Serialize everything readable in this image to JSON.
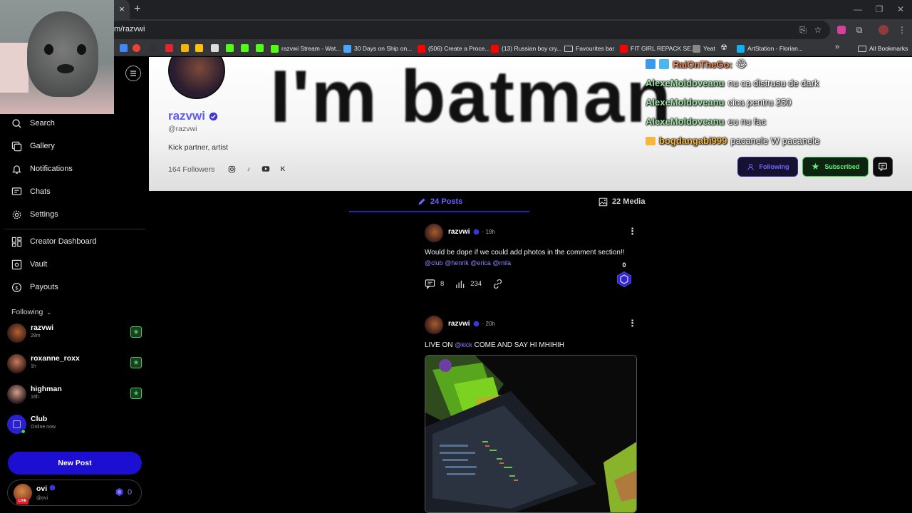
{
  "browser": {
    "url": "m/razvwi",
    "new_tab": "+",
    "tab_close": "×",
    "bookmarks": [
      {
        "label": "razvwi Stream - Wat...",
        "color": "#53fc18"
      },
      {
        "label": "30 Days on Ship on...",
        "color": "#4aa3ff"
      },
      {
        "label": "(506) Create a Proce...",
        "color": "#ff0000"
      },
      {
        "label": "(13) Russian boy cry...",
        "color": "#ff0000"
      },
      {
        "label": "Favourites bar",
        "color": "folder"
      },
      {
        "label": "FIT GIRL REPACK SE...",
        "color": "#ff0000"
      },
      {
        "label": "Yeat",
        "color": "#888888"
      },
      {
        "label": "ArtStation - Florian...",
        "color": "#13aff0"
      }
    ],
    "more_bookmarks": "»",
    "all_bookmarks": "All Bookmarks"
  },
  "sidebar": {
    "nav": [
      {
        "label": "Search",
        "icon": "search-icon"
      },
      {
        "label": "Gallery",
        "icon": "gallery-icon"
      },
      {
        "label": "Notifications",
        "icon": "bell-icon"
      },
      {
        "label": "Chats",
        "icon": "chat-icon"
      },
      {
        "label": "Settings",
        "icon": "gear-icon"
      }
    ],
    "creator": [
      {
        "label": "Creator Dashboard",
        "icon": "dashboard-icon"
      },
      {
        "label": "Vault",
        "icon": "vault-icon"
      },
      {
        "label": "Payouts",
        "icon": "dollar-icon"
      }
    ],
    "following_label": "Following",
    "following": [
      {
        "name": "razvwi",
        "time": "28m"
      },
      {
        "name": "roxanne_roxx",
        "time": "1h"
      },
      {
        "name": "highman",
        "time": "16h"
      },
      {
        "name": "Club",
        "time": "Online now"
      }
    ],
    "new_post": "New Post",
    "user": {
      "name": "ovi",
      "handle": "@ovi",
      "live": "LIVE",
      "coins": "0"
    }
  },
  "profile": {
    "banner_text": "I'm batman",
    "name": "razvwi",
    "handle": "@razvwi",
    "bio": "Kick partner, artist",
    "followers": "164 Followers",
    "socials": [
      "instagram-icon",
      "tiktok-icon",
      "youtube-icon",
      "kick-icon"
    ],
    "kick_letter": "K",
    "following_btn": "Following",
    "subscribed_btn": "Subscribed"
  },
  "chat_overlay": [
    {
      "user": "RaiOnTheGo:",
      "msg": "😂"
    },
    {
      "user": "AlexeMoldoveanu",
      "msg": "nu ca distrusu de dark"
    },
    {
      "user": "AlexeMoldoveanu",
      "msg": "cica pentru 250"
    },
    {
      "user": "AlexeMoldoveanu",
      "msg": "eu nu fac"
    },
    {
      "user": "bogdangabi999",
      "msg": "pacanele W pacanele"
    }
  ],
  "tabs": {
    "posts": "24 Posts",
    "media": "22 Media"
  },
  "posts": [
    {
      "author": "razvwi",
      "time": "· 19h",
      "text": "Would be dope if we could add photos in the comment section!!",
      "mentions": "@club @henrik @erica @mila",
      "comments": "8",
      "views": "234",
      "coins": "0"
    },
    {
      "author": "razvwi",
      "time": "· 20h",
      "text_before": "LIVE ON",
      "mention": "@kick",
      "text_after": "COME AND SAY HI MHIHIH"
    }
  ],
  "colors": {
    "accent": "#1d0fd1",
    "accent_text": "#6e63ff",
    "success": "#35d35a",
    "live": "#e11c2a"
  }
}
